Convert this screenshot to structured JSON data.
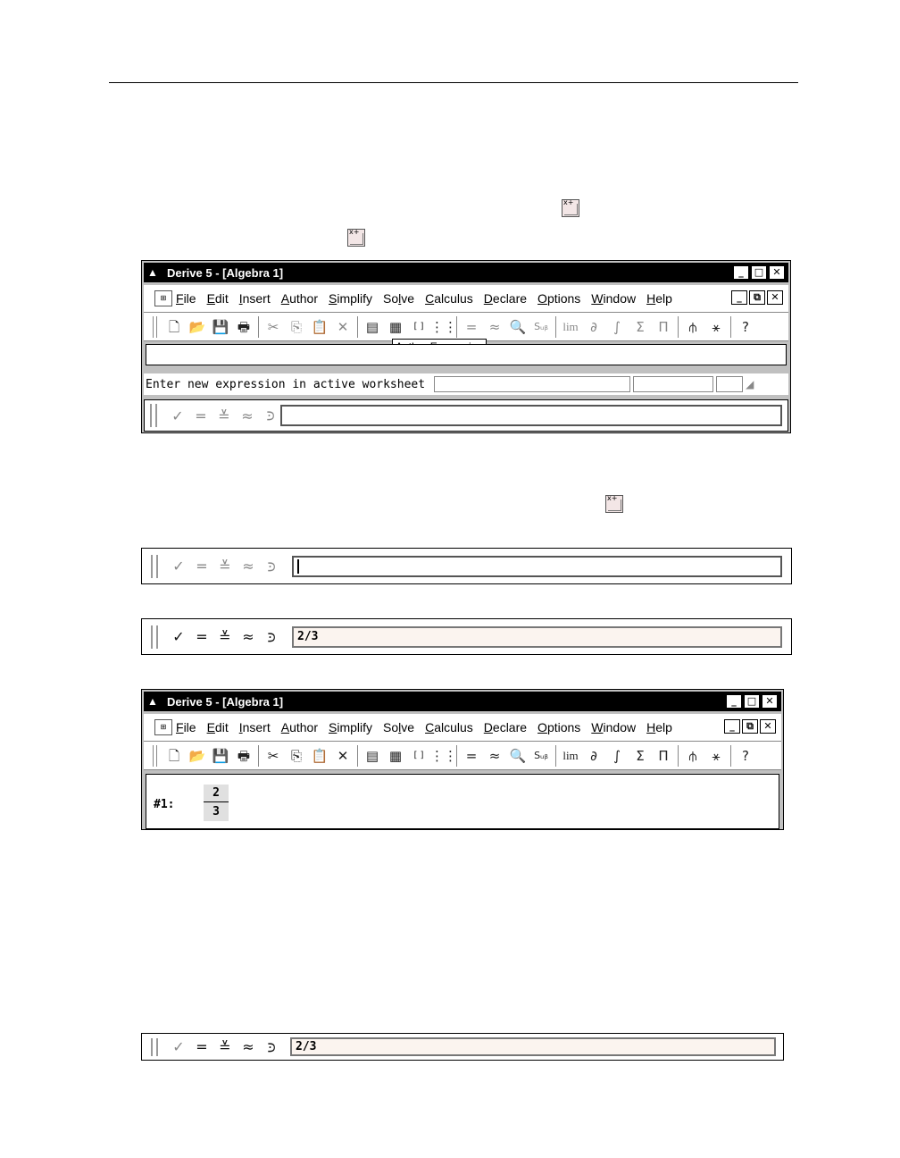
{
  "window": {
    "title": "Derive 5 - [Algebra 1]",
    "controls": {
      "minimize": "_",
      "maximize": "□",
      "close": "✕",
      "restore": "⧉"
    }
  },
  "menu": {
    "items": [
      {
        "u": "F",
        "rest": "ile"
      },
      {
        "u": "E",
        "rest": "dit"
      },
      {
        "u": "I",
        "rest": "nsert"
      },
      {
        "u": "A",
        "rest": "uthor"
      },
      {
        "u": "S",
        "rest": "implify"
      },
      {
        "pre": "So",
        "u": "l",
        "rest": "ve"
      },
      {
        "u": "C",
        "rest": "alculus"
      },
      {
        "u": "D",
        "rest": "eclare"
      },
      {
        "u": "O",
        "rest": "ptions"
      },
      {
        "u": "W",
        "rest": "indow"
      },
      {
        "u": "H",
        "rest": "elp"
      }
    ]
  },
  "toolbar": {
    "new": "🗋",
    "open": "📂",
    "save": "💾",
    "print": "🖶",
    "cut": "✂",
    "copy": "⎘",
    "paste": "📋",
    "delete": "✕",
    "author_text": "▤",
    "author_expr": "▦",
    "vector": "[ ]",
    "matrix": "⋮⋮",
    "simplify": "=",
    "approx": "≈",
    "expand": "🔍",
    "sub": "Sᵤᵦ",
    "lim": "lim",
    "diff": "∂",
    "int": "∫",
    "sum": "Σ",
    "prod": "Π",
    "plot2d": "⫛",
    "plot3d": "⚹",
    "help": "?"
  },
  "tooltip": "Author Expression",
  "status_text": "Enter new expression in active worksheet",
  "entry": {
    "buttons": {
      "check": "✓",
      "simplify": "=",
      "approx_eq": "≚",
      "approx": "≈",
      "expand": "⪾"
    },
    "typed_value": "2/3"
  },
  "worksheet": {
    "expr_label": "#1:",
    "numerator": "2",
    "denominator": "3"
  }
}
